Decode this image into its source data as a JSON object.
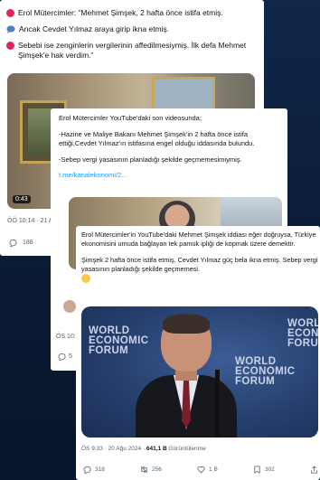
{
  "card1": {
    "line1": "Erol Mütercimler: “Mehmet Şimşek, 2 hafta önce istifa etmiş.",
    "line2": "Ancak Cevdet Yılmaz araya girip ikna etmiş.",
    "line3": "Sebebi ise zenginlerin vergilerinin affedilmesiymiş. İlk defa Mehmet Şimşek'e hak verdim.”",
    "duration": "0:43",
    "meta": "ÖÖ 10:14 · 21 A",
    "replies": "188"
  },
  "card2": {
    "p1": "Erol Mütercimler YouTube'daki son videosunda;",
    "p2": "-Hazine ve Maliye Bakanı Mehmet Şimşek'in 2 hafta önce istifa ettiği,Cevdet Yılmaz'ın istifasına engel olduğu iddasında bulundu.",
    "p3": "-Sebep vergi yasasının planladığı şekilde geçmemesimiymiş.",
    "link": "t.me/kanalekonomi/2...",
    "meta": "ÖS 10:",
    "replies": "5"
  },
  "card3": {
    "p1": "Erol Mütercimler'in YouTube'daki Mehmet Şimşek iddiası eğer doğruysa, Türkiye ekonomisini umuda bağlayan tek pamuk ipliği de kopmak üzere demektir.",
    "p2": "Şimşek 2 hafta önce istifa etmiş. Cevdet Yılmaz güç bela ikna etmiş. Sebep vergi yasasının planladığı şekilde geçmemesi.",
    "wef_text": "WORLD ECONOMIC FORUM",
    "meta_time": "ÖS 9:33 · 20 Ağu 2024 · ",
    "meta_views": "641,1 B",
    "meta_views_label": " Görüntülenme",
    "replies": "318",
    "reposts": "256",
    "likes": "1 B",
    "bookmarks": "302"
  },
  "colors": {
    "accent": "#1d9bf0",
    "red_dot": "#e0245e",
    "muted": "#536471"
  }
}
